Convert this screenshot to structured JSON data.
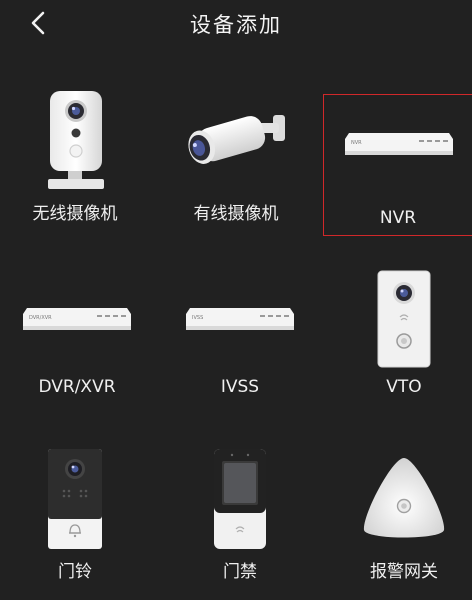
{
  "header": {
    "title": "设备添加",
    "back_icon": "chevron-left-icon"
  },
  "devices": [
    {
      "label": "无线摄像机",
      "icon": "wireless-camera-icon",
      "selected": false
    },
    {
      "label": "有线摄像机",
      "icon": "wired-camera-icon",
      "selected": false
    },
    {
      "label": "NVR",
      "icon": "nvr-icon",
      "selected": true,
      "device_text": "NVR"
    },
    {
      "label": "DVR/XVR",
      "icon": "dvr-xvr-icon",
      "selected": false,
      "device_text": "DVR/XVR"
    },
    {
      "label": "IVSS",
      "icon": "ivss-icon",
      "selected": false,
      "device_text": "IVSS"
    },
    {
      "label": "VTO",
      "icon": "vto-icon",
      "selected": false
    },
    {
      "label": "门铃",
      "icon": "doorbell-icon",
      "selected": false
    },
    {
      "label": "门禁",
      "icon": "access-control-icon",
      "selected": false
    },
    {
      "label": "报警网关",
      "icon": "alarm-gateway-icon",
      "selected": false
    }
  ],
  "colors": {
    "background": "#212121",
    "selected_border": "#d0282a",
    "text": "#f0f0f0"
  }
}
